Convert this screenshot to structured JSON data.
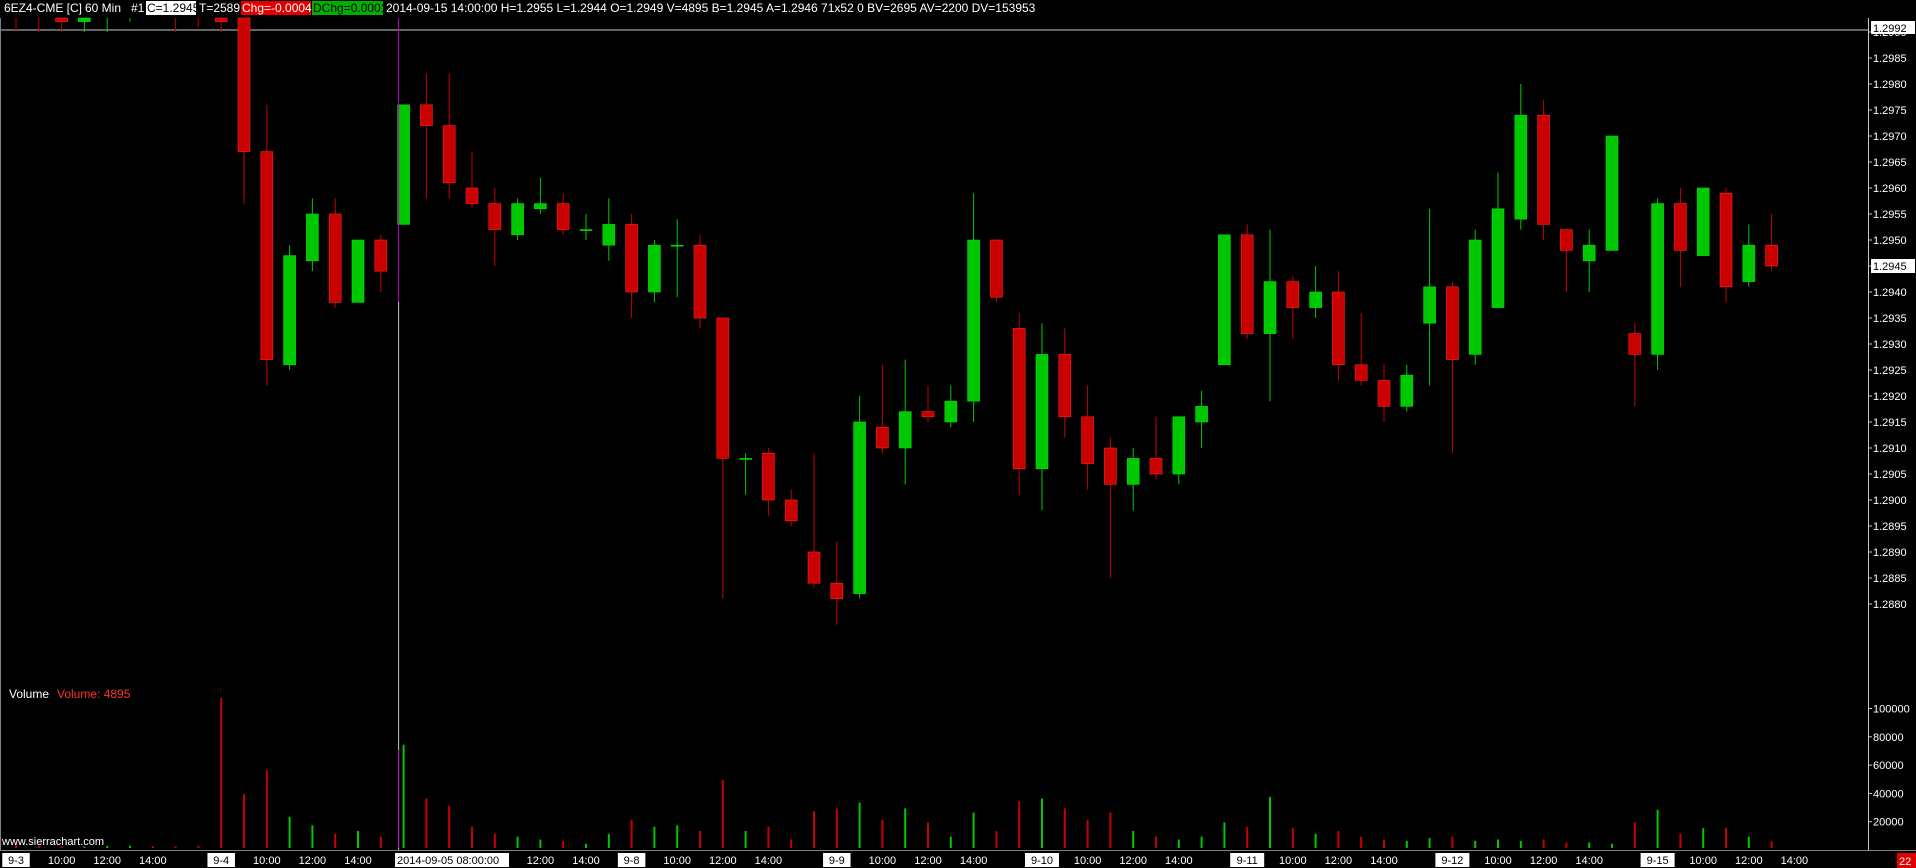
{
  "header": {
    "symbol": "6EZ4-CME [C]",
    "interval": "60 Min",
    "chart_number": "#1",
    "close_box": "C=1.2945",
    "time_count": "T=2589",
    "chg_box": "Chg=-0.0004",
    "dchg_box": "DChg=0.0001",
    "bar_info": "2014-09-15 14:00:00 H=1.2955 L=1.2944 O=1.2949 V=4895 B=1.2945 A=1.2946 71x52 0 BV=2695 AV=2200 DV=153953"
  },
  "volume_panel": {
    "label": "Volume",
    "value_label": "Volume: 4895"
  },
  "watermark": "www.sierrachart.com",
  "footer": {
    "cursor_time": "2014-09-05  08:00:00",
    "bar_count": "22"
  },
  "price_axis": {
    "current_price": "1.2945",
    "top_price": "1.2992"
  },
  "colors": {
    "up": "#00c800",
    "down": "#c80000",
    "background": "#000000",
    "cursor": "#c000c0"
  },
  "chart_data": {
    "type": "candlestick",
    "price_ticks": [
      "1.2990",
      "1.2985",
      "1.2980",
      "1.2975",
      "1.2970",
      "1.2965",
      "1.2960",
      "1.2955",
      "1.2950",
      "1.2945",
      "1.2940",
      "1.2935",
      "1.2930",
      "1.2925",
      "1.2920",
      "1.2915",
      "1.2910",
      "1.2905",
      "1.2900",
      "1.2895",
      "1.2890",
      "1.2885",
      "1.2880"
    ],
    "volume_ticks": [
      "100000",
      "80000",
      "60000",
      "40000",
      "20000"
    ],
    "x_labels": [
      {
        "i": 0,
        "text": "9-3",
        "date": true
      },
      {
        "i": 2,
        "text": "10:00"
      },
      {
        "i": 4,
        "text": "12:00"
      },
      {
        "i": 6,
        "text": "14:00"
      },
      {
        "i": 9,
        "text": "9-4",
        "date": true
      },
      {
        "i": 11,
        "text": "10:00"
      },
      {
        "i": 13,
        "text": "12:00"
      },
      {
        "i": 15,
        "text": "14:00"
      },
      {
        "i": 21,
        "text": "10:00"
      },
      {
        "i": 23,
        "text": "12:00"
      },
      {
        "i": 25,
        "text": "14:00"
      },
      {
        "i": 27,
        "text": "9-8",
        "date": true
      },
      {
        "i": 29,
        "text": "10:00"
      },
      {
        "i": 31,
        "text": "12:00"
      },
      {
        "i": 33,
        "text": "14:00"
      },
      {
        "i": 36,
        "text": "9-9",
        "date": true
      },
      {
        "i": 38,
        "text": "10:00"
      },
      {
        "i": 40,
        "text": "12:00"
      },
      {
        "i": 42,
        "text": "14:00"
      },
      {
        "i": 45,
        "text": "9-10",
        "date": true
      },
      {
        "i": 47,
        "text": "10:00"
      },
      {
        "i": 49,
        "text": "12:00"
      },
      {
        "i": 51,
        "text": "14:00"
      },
      {
        "i": 54,
        "text": "9-11",
        "date": true
      },
      {
        "i": 56,
        "text": "10:00"
      },
      {
        "i": 58,
        "text": "12:00"
      },
      {
        "i": 60,
        "text": "14:00"
      },
      {
        "i": 63,
        "text": "9-12",
        "date": true
      },
      {
        "i": 65,
        "text": "10:00"
      },
      {
        "i": 67,
        "text": "12:00"
      },
      {
        "i": 69,
        "text": "14:00"
      },
      {
        "i": 72,
        "text": "9-15",
        "date": true
      },
      {
        "i": 74,
        "text": "10:00"
      },
      {
        "i": 76,
        "text": "12:00"
      },
      {
        "i": 78,
        "text": "14:00"
      }
    ],
    "candles": [
      {
        "o": 1.3012,
        "h": 1.302,
        "l": 1.299,
        "c": 1.2996,
        "v": 2000
      },
      {
        "o": 1.2996,
        "h": 1.3,
        "l": 1.299,
        "c": 1.2993,
        "v": 1500
      },
      {
        "o": 1.2993,
        "h": 1.2997,
        "l": 1.299,
        "c": 1.2992,
        "v": 1200
      },
      {
        "o": 1.2992,
        "h": 1.2996,
        "l": 1.299,
        "c": 1.2994,
        "v": 1000
      },
      {
        "o": 1.2994,
        "h": 1.2998,
        "l": 1.299,
        "c": 1.2996,
        "v": 1500
      },
      {
        "o": 1.2996,
        "h": 1.3,
        "l": 1.2992,
        "c": 1.2998,
        "v": 1600
      },
      {
        "o": 1.2998,
        "h": 1.3002,
        "l": 1.2993,
        "c": 1.2995,
        "v": 1400
      },
      {
        "o": 1.2995,
        "h": 1.2999,
        "l": 1.299,
        "c": 1.2994,
        "v": 1200
      },
      {
        "o": 1.2994,
        "h": 1.2998,
        "l": 1.2991,
        "c": 1.2993,
        "v": 1500
      },
      {
        "o": 1.2993,
        "h": 1.3,
        "l": 1.299,
        "c": 1.2992,
        "v": 106000
      },
      {
        "o": 1.302,
        "h": 1.303,
        "l": 1.2957,
        "c": 1.2967,
        "v": 38000
      },
      {
        "o": 1.2967,
        "h": 1.2976,
        "l": 1.2922,
        "c": 1.2927,
        "v": 55000
      },
      {
        "o": 1.2926,
        "h": 1.2949,
        "l": 1.2925,
        "c": 1.2947,
        "v": 22000
      },
      {
        "o": 1.2946,
        "h": 1.2958,
        "l": 1.2944,
        "c": 1.2955,
        "v": 16000
      },
      {
        "o": 1.2955,
        "h": 1.2958,
        "l": 1.2937,
        "c": 1.2938,
        "v": 10000
      },
      {
        "o": 1.2938,
        "h": 1.295,
        "l": 1.2938,
        "c": 1.295,
        "v": 12000
      },
      {
        "o": 1.295,
        "h": 1.2951,
        "l": 1.294,
        "c": 1.2944,
        "v": 8000
      },
      {
        "o": 1.2953,
        "h": 1.2976,
        "l": 1.2953,
        "c": 1.2976,
        "v": 73000
      },
      {
        "o": 1.2976,
        "h": 1.2982,
        "l": 1.2958,
        "c": 1.2972,
        "v": 35000
      },
      {
        "o": 1.2972,
        "h": 1.2982,
        "l": 1.2958,
        "c": 1.2961,
        "v": 30000
      },
      {
        "o": 1.296,
        "h": 1.2967,
        "l": 1.2956,
        "c": 1.2957,
        "v": 15000
      },
      {
        "o": 1.2957,
        "h": 1.296,
        "l": 1.2945,
        "c": 1.2952,
        "v": 10000
      },
      {
        "o": 1.2951,
        "h": 1.2958,
        "l": 1.295,
        "c": 1.2957,
        "v": 8000
      },
      {
        "o": 1.2956,
        "h": 1.2962,
        "l": 1.2955,
        "c": 1.2957,
        "v": 6000
      },
      {
        "o": 1.2957,
        "h": 1.2959,
        "l": 1.2951,
        "c": 1.2952,
        "v": 5000
      },
      {
        "o": 1.2952,
        "h": 1.2955,
        "l": 1.295,
        "c": 1.2952,
        "v": 3000
      },
      {
        "o": 1.2949,
        "h": 1.2958,
        "l": 1.2946,
        "c": 1.2953,
        "v": 10000
      },
      {
        "o": 1.2953,
        "h": 1.2955,
        "l": 1.2935,
        "c": 1.294,
        "v": 20000
      },
      {
        "o": 1.294,
        "h": 1.295,
        "l": 1.2938,
        "c": 1.2949,
        "v": 15000
      },
      {
        "o": 1.2949,
        "h": 1.2954,
        "l": 1.2939,
        "c": 1.2949,
        "v": 16000
      },
      {
        "o": 1.2949,
        "h": 1.2951,
        "l": 1.2933,
        "c": 1.2935,
        "v": 12000
      },
      {
        "o": 1.2935,
        "h": 1.2935,
        "l": 1.2881,
        "c": 1.2908,
        "v": 48000
      },
      {
        "o": 1.2908,
        "h": 1.2909,
        "l": 1.2901,
        "c": 1.2908,
        "v": 12000
      },
      {
        "o": 1.2909,
        "h": 1.291,
        "l": 1.2897,
        "c": 1.29,
        "v": 15000
      },
      {
        "o": 1.29,
        "h": 1.2902,
        "l": 1.2895,
        "c": 1.2896,
        "v": 6000
      },
      {
        "o": 1.289,
        "h": 1.2909,
        "l": 1.2883,
        "c": 1.2884,
        "v": 26000
      },
      {
        "o": 1.2884,
        "h": 1.2892,
        "l": 1.2876,
        "c": 1.2881,
        "v": 28000
      },
      {
        "o": 1.2882,
        "h": 1.292,
        "l": 1.2881,
        "c": 1.2915,
        "v": 32000
      },
      {
        "o": 1.2914,
        "h": 1.2926,
        "l": 1.2909,
        "c": 1.291,
        "v": 20000
      },
      {
        "o": 1.291,
        "h": 1.2927,
        "l": 1.2903,
        "c": 1.2917,
        "v": 28000
      },
      {
        "o": 1.2917,
        "h": 1.2922,
        "l": 1.2915,
        "c": 1.2916,
        "v": 18000
      },
      {
        "o": 1.2915,
        "h": 1.2922,
        "l": 1.2914,
        "c": 1.2919,
        "v": 8000
      },
      {
        "o": 1.2919,
        "h": 1.2959,
        "l": 1.2915,
        "c": 1.295,
        "v": 25000
      },
      {
        "o": 1.295,
        "h": 1.295,
        "l": 1.2938,
        "c": 1.2939,
        "v": 12000
      },
      {
        "o": 1.2933,
        "h": 1.2936,
        "l": 1.2901,
        "c": 1.2906,
        "v": 33000
      },
      {
        "o": 1.2906,
        "h": 1.2934,
        "l": 1.2898,
        "c": 1.2928,
        "v": 35000
      },
      {
        "o": 1.2928,
        "h": 1.2933,
        "l": 1.2912,
        "c": 1.2916,
        "v": 28000
      },
      {
        "o": 1.2916,
        "h": 1.2922,
        "l": 1.2902,
        "c": 1.2907,
        "v": 20000
      },
      {
        "o": 1.291,
        "h": 1.2912,
        "l": 1.2885,
        "c": 1.2903,
        "v": 25000
      },
      {
        "o": 1.2903,
        "h": 1.291,
        "l": 1.2898,
        "c": 1.2908,
        "v": 12000
      },
      {
        "o": 1.2908,
        "h": 1.2916,
        "l": 1.2904,
        "c": 1.2905,
        "v": 8000
      },
      {
        "o": 1.2905,
        "h": 1.2916,
        "l": 1.2903,
        "c": 1.2916,
        "v": 6000
      },
      {
        "o": 1.2915,
        "h": 1.2921,
        "l": 1.291,
        "c": 1.2918,
        "v": 8000
      },
      {
        "o": 1.2926,
        "h": 1.2951,
        "l": 1.2926,
        "c": 1.2951,
        "v": 18000
      },
      {
        "o": 1.2951,
        "h": 1.2953,
        "l": 1.2931,
        "c": 1.2932,
        "v": 15000
      },
      {
        "o": 1.2932,
        "h": 1.2952,
        "l": 1.2919,
        "c": 1.2942,
        "v": 36000
      },
      {
        "o": 1.2942,
        "h": 1.2943,
        "l": 1.2931,
        "c": 1.2937,
        "v": 14000
      },
      {
        "o": 1.2937,
        "h": 1.2945,
        "l": 1.2935,
        "c": 1.294,
        "v": 10000
      },
      {
        "o": 1.294,
        "h": 1.2944,
        "l": 1.2923,
        "c": 1.2926,
        "v": 12000
      },
      {
        "o": 1.2926,
        "h": 1.2936,
        "l": 1.2922,
        "c": 1.2923,
        "v": 8000
      },
      {
        "o": 1.2923,
        "h": 1.2926,
        "l": 1.2915,
        "c": 1.2918,
        "v": 6000
      },
      {
        "o": 1.2918,
        "h": 1.2926,
        "l": 1.2917,
        "c": 1.2924,
        "v": 5000
      },
      {
        "o": 1.2934,
        "h": 1.2956,
        "l": 1.2922,
        "c": 1.2941,
        "v": 7000
      },
      {
        "o": 1.2941,
        "h": 1.2942,
        "l": 1.2909,
        "c": 1.2927,
        "v": 8000
      },
      {
        "o": 1.2928,
        "h": 1.2952,
        "l": 1.2926,
        "c": 1.295,
        "v": 5000
      },
      {
        "o": 1.2937,
        "h": 1.2963,
        "l": 1.2937,
        "c": 1.2956,
        "v": 6000
      },
      {
        "o": 1.2954,
        "h": 1.298,
        "l": 1.2952,
        "c": 1.2974,
        "v": 5000
      },
      {
        "o": 1.2974,
        "h": 1.2977,
        "l": 1.295,
        "c": 1.2953,
        "v": 6000
      },
      {
        "o": 1.2952,
        "h": 1.2952,
        "l": 1.294,
        "c": 1.2948,
        "v": 4000
      },
      {
        "o": 1.2946,
        "h": 1.2952,
        "l": 1.294,
        "c": 1.2949,
        "v": 4000
      },
      {
        "o": 1.2948,
        "h": 1.297,
        "l": 1.2948,
        "c": 1.297,
        "v": 3000
      },
      {
        "o": 1.2932,
        "h": 1.2934,
        "l": 1.2918,
        "c": 1.2928,
        "v": 18000
      },
      {
        "o": 1.2928,
        "h": 1.2958,
        "l": 1.2925,
        "c": 1.2957,
        "v": 27000
      },
      {
        "o": 1.2957,
        "h": 1.296,
        "l": 1.2941,
        "c": 1.2948,
        "v": 10000
      },
      {
        "o": 1.2947,
        "h": 1.296,
        "l": 1.2947,
        "c": 1.296,
        "v": 14000
      },
      {
        "o": 1.2959,
        "h": 1.296,
        "l": 1.2938,
        "c": 1.2941,
        "v": 14000
      },
      {
        "o": 1.2942,
        "h": 1.2953,
        "l": 1.2941,
        "c": 1.2949,
        "v": 8000
      },
      {
        "o": 1.2949,
        "h": 1.2955,
        "l": 1.2944,
        "c": 1.2945,
        "v": 4895
      }
    ]
  }
}
